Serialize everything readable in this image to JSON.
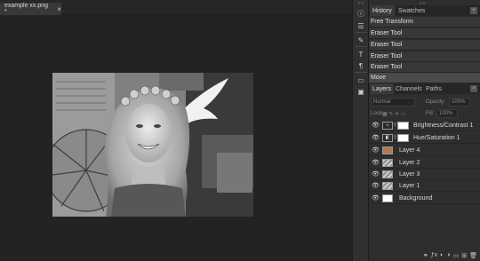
{
  "document": {
    "tab_title": "example xx.png *",
    "tab_close": "×"
  },
  "tool_strip": {
    "grip": "«»",
    "buttons": [
      {
        "name": "info",
        "glyph": "ⓘ"
      },
      {
        "name": "menu",
        "glyph": "☰"
      },
      {
        "name": "brush-settings",
        "glyph": "✎"
      },
      {
        "name": "character",
        "glyph": "T"
      },
      {
        "name": "paragraph",
        "glyph": "¶"
      },
      {
        "name": "css",
        "glyph": "▭"
      },
      {
        "name": "image-properties",
        "glyph": "▣"
      }
    ]
  },
  "history_panel": {
    "grip": "«»",
    "tabs": [
      "History",
      "Swatches"
    ],
    "close": "×",
    "items": [
      "Free Transform",
      "Eraser Tool",
      "Eraser Tool",
      "Eraser Tool",
      "Eraser Tool",
      "Move"
    ]
  },
  "layers_panel": {
    "tabs": [
      "Layers",
      "Channels",
      "Paths"
    ],
    "close": "×",
    "blend_mode": "Normal",
    "opacity_label": "Opacity:",
    "opacity_value": "100%",
    "lock_label": "Lock:",
    "lock_icons": "▦ ✎ ✛ ▭",
    "fill_label": "Fill:",
    "fill_value": "100%",
    "layers": [
      {
        "name": "Brightness/Contrast 1",
        "thumb": "adj",
        "adj_glyph": "☼",
        "has_mask": true
      },
      {
        "name": "Hue/Saturation 1",
        "thumb": "adj",
        "adj_glyph": "◧",
        "has_mask": true
      },
      {
        "name": "Layer 4",
        "thumb": "warm",
        "has_mask": false
      },
      {
        "name": "Layer 2",
        "thumb": "photo",
        "has_mask": false
      },
      {
        "name": "Layer 3",
        "thumb": "photo",
        "has_mask": false
      },
      {
        "name": "Layer 1",
        "thumb": "photo",
        "has_mask": false
      },
      {
        "name": "Background",
        "thumb": "white",
        "has_mask": false
      }
    ],
    "eye_glyph": "👁",
    "bottom_icons": [
      "⚭",
      "ƒx",
      "◐",
      "◑",
      "▭",
      "⊞",
      "🗑"
    ]
  },
  "colors": {
    "canvas_bg": "#232323",
    "panel_bg": "#2e2e2e",
    "selected_row": "#4a4a4a"
  }
}
